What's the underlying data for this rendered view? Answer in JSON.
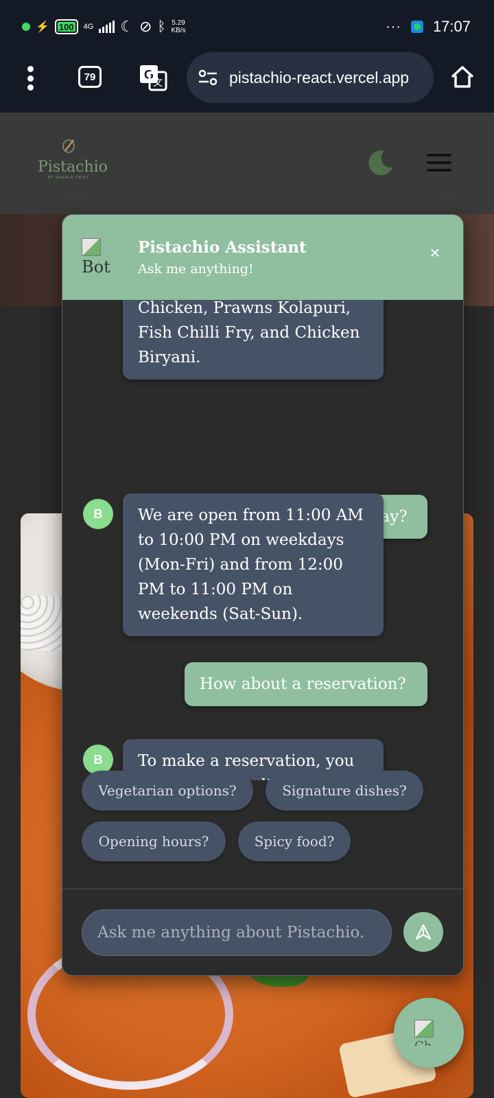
{
  "status_bar": {
    "battery": "100",
    "network": "4G",
    "speed_value": "5.29",
    "speed_unit": "KB/s",
    "more": "···",
    "time": "17:07"
  },
  "browser": {
    "tab_count": "79",
    "url": "pistachio-react.vercel.app"
  },
  "site": {
    "logo_name": "Pistachio",
    "logo_sub": "BY MASALA TWIST"
  },
  "chat": {
    "bot_img_alt": "Bot",
    "title": "Pistachio Assistant",
    "subtitle": "Ask me anything!",
    "close": "×",
    "avatar_letter": "B",
    "messages": [
      {
        "role": "bot",
        "text": "Chicken, Prawns Kolapuri, Fish Chilli Fry, and Chicken Biryani."
      },
      {
        "role": "user",
        "text": "You are open all day?"
      },
      {
        "role": "bot",
        "text": "We are open from 11:00 AM to 10:00 PM on weekdays (Mon-Fri) and from 12:00 PM to 11:00 PM on weekends (Sat-Sun)."
      },
      {
        "role": "user",
        "text": "How about a reservation?"
      },
      {
        "role": "bot",
        "text": "To make a reservation, you can book your dinner"
      }
    ],
    "suggestions": [
      "Vegetarian options?",
      "Signature dishes?",
      "Opening hours?",
      "Spicy food?"
    ],
    "input_placeholder": "Ask me anything about Pistachio."
  },
  "fab": {
    "alt": "Ch"
  },
  "colors": {
    "accent": "#8fbf9e",
    "bot_bubble": "#465266",
    "avatar": "#8bdc8e",
    "status_bg": "#141a25"
  }
}
